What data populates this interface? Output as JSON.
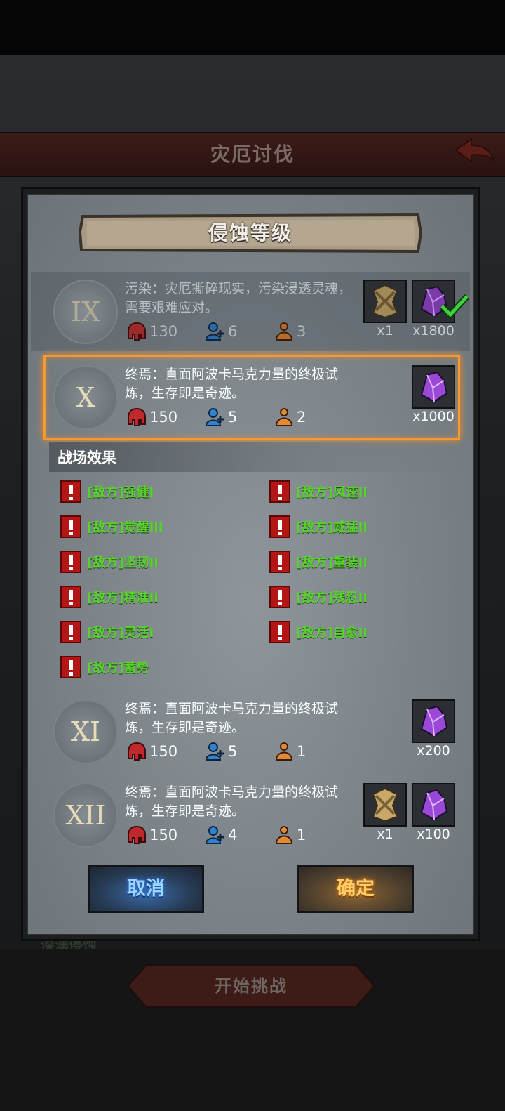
{
  "screen": {
    "header_title": "灾厄讨伐",
    "start_button_label": "开始挑战",
    "underlying_text": "深渊侵蚀"
  },
  "dialog": {
    "title": "侵蚀等级",
    "levels": [
      {
        "roman": "IX",
        "desc_line1": "污染：灾厄撕碎现实，污染浸透灵魂，",
        "desc_line2": "需要艰难应对。",
        "skull": "130",
        "players": "6",
        "revives": "3",
        "rewards": [
          {
            "icon": "emblem-icon",
            "count": "x1"
          },
          {
            "icon": "purple-crystal-icon",
            "count": "x1800",
            "claimed": true
          }
        ]
      },
      {
        "roman": "X",
        "desc_line1": "终焉：直面阿波卡马克力量的终极试",
        "desc_line2": "炼，生存即是奇迹。",
        "skull": "150",
        "players": "5",
        "revives": "2",
        "rewards": [
          {
            "icon": "purple-crystal-icon",
            "count": "x1000"
          }
        ]
      },
      {
        "roman": "XI",
        "desc_line1": "终焉：直面阿波卡马克力量的终极试",
        "desc_line2": "炼，生存即是奇迹。",
        "skull": "150",
        "players": "5",
        "revives": "1",
        "rewards": [
          {
            "icon": "purple-crystal-icon",
            "count": "x200"
          }
        ]
      },
      {
        "roman": "XII",
        "desc_line1": "终焉：直面阿波卡马克力量的终极试",
        "desc_line2": "炼，生存即是奇迹。",
        "skull": "150",
        "players": "4",
        "revives": "1",
        "rewards": [
          {
            "icon": "emblem-icon",
            "count": "x1"
          },
          {
            "icon": "purple-crystal-icon",
            "count": "x100"
          }
        ]
      }
    ],
    "selected_level": "X",
    "effects_title": "战场效果",
    "effects": [
      "[敌方]强健I",
      "[敌方]风速II",
      "[敌方]觉醒III",
      "[敌方]威猛II",
      "[敌方]坚韧II",
      "[敌方]重装II",
      "[敌方]精准II",
      "[敌方]残忍II",
      "[敌方]灵活I",
      "[敌方]自愈II",
      "[敌方]蓄势"
    ],
    "cancel_label": "取消",
    "confirm_label": "确定"
  },
  "colors": {
    "selected_border": "#f59a2e",
    "effect_text": "#58d22c",
    "warning_red": "#b41515"
  }
}
